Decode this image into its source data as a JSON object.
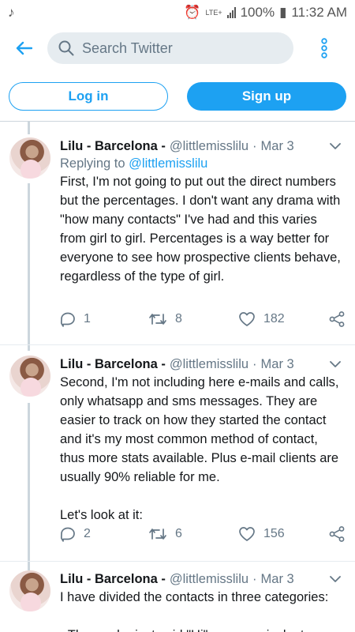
{
  "status_bar": {
    "time": "11:32 AM",
    "battery": "100%",
    "network": "LTE+"
  },
  "search": {
    "placeholder": "Search Twitter"
  },
  "auth": {
    "login_label": "Log in",
    "signup_label": "Sign up"
  },
  "colors": {
    "brand": "#1da1f2",
    "secondary_text": "#657786"
  },
  "tweets": [
    {
      "name": "Lilu - Barcelona -",
      "handle": "@littlemisslilu",
      "dot": "·",
      "date": "Mar 3",
      "replying_prefix": "Replying to",
      "replying_to": "@littlemisslilu",
      "text": "First, I'm not going to put out the direct numbers but the percentages. I don't want any drama with \"how many contacts\" I've had and this varies from girl to girl. Percentages is a way better for everyone to see how prospective clients behave, regardless of the type of girl.",
      "replies": "1",
      "retweets": "8",
      "likes": "182"
    },
    {
      "name": "Lilu - Barcelona -",
      "handle": "@littlemisslilu",
      "dot": "·",
      "date": "Mar 3",
      "text": "Second, I'm not including here e-mails and calls, only whatsapp and sms messages. They are easier to track on how they started the contact and it's my most common method of contact, thus more stats available. Plus e-mail clients are usually 90% reliable for me.\n\nLet's look at it:",
      "replies": "2",
      "retweets": "6",
      "likes": "156"
    },
    {
      "name": "Lilu - Barcelona -",
      "handle": "@littlemisslilu",
      "dot": "·",
      "date": "Mar 3",
      "text": "I have divided the contacts in three categories:\n\n - Those who just said \"Hi\" or an equivalent"
    }
  ]
}
